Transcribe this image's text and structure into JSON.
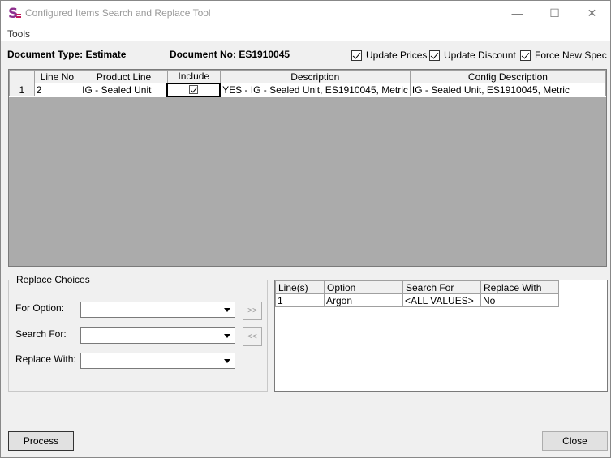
{
  "window": {
    "title": "Configured Items Search and Replace Tool",
    "minimize": "—",
    "maximize": "☐",
    "close": "✕"
  },
  "menu": {
    "tools": "Tools"
  },
  "header": {
    "doc_type": "Document Type: Estimate",
    "doc_no": "Document No: ES1910045",
    "update_prices": "Update Prices",
    "update_discount": "Update Discount",
    "force_new_spec": "Force New Spec"
  },
  "main_grid": {
    "columns": [
      "Line No",
      "Product Line",
      "Include",
      "Description",
      "Config Description"
    ],
    "rows": [
      {
        "row_num": "1",
        "line_no": "2",
        "product_line": "IG - Sealed Unit",
        "include": true,
        "description": "YES - IG - Sealed Unit, ES1910045, Metric",
        "config_description": "IG - Sealed Unit, ES1910045, Metric"
      }
    ]
  },
  "replace_choices": {
    "legend": "Replace Choices",
    "for_option_label": "For Option:",
    "search_for_label": "Search For:",
    "replace_with_label": "Replace With:",
    "add_button": ">>",
    "remove_button": "<<"
  },
  "choices_grid": {
    "columns": [
      "Line(s)",
      "Option",
      "Search For",
      "Replace With"
    ],
    "rows": [
      {
        "lines": "1",
        "option": "Argon",
        "search_for": "<ALL VALUES>",
        "replace_with": "No"
      }
    ]
  },
  "footer": {
    "process": "Process",
    "close": "Close"
  },
  "colors": {
    "grid_background": "#ababab",
    "window_background": "#f0f0f0",
    "icon_accent": "#c2185b"
  },
  "icons": {
    "app": "s-logo-icon"
  }
}
